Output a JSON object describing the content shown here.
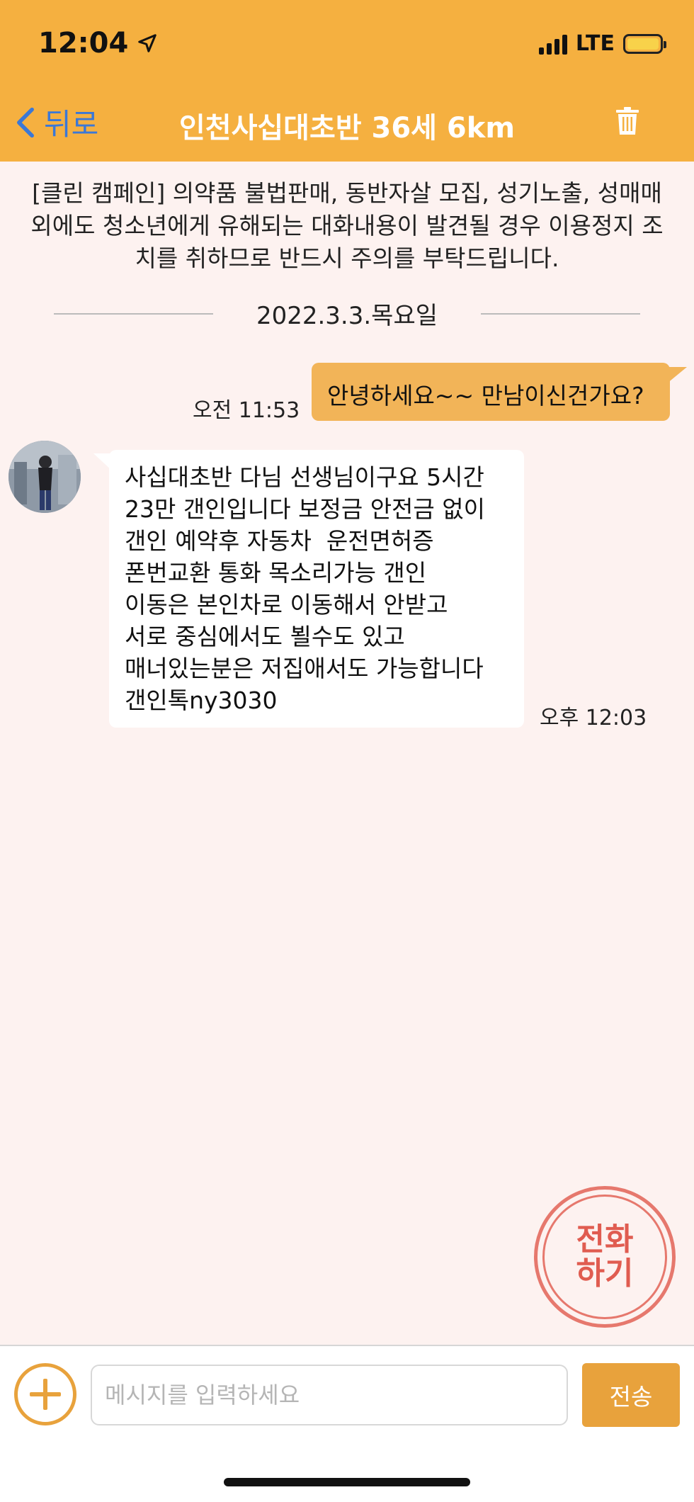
{
  "status_bar": {
    "time": "12:04",
    "network": "LTE",
    "battery_level": 1.0
  },
  "nav": {
    "back_label": "뒤로",
    "title": "인천사십대초반 36세 6km"
  },
  "notice": "[클린 캠페인] 의약품 불법판매, 동반자살 모집, 성기노출, 성매매 외에도 청소년에게 유해되는 대화내용이 발견될 경우 이용정지 조치를 취하므로 반드시 주의를 부탁드립니다.",
  "date_divider": "2022.3.3.목요일",
  "messages": {
    "outgoing": {
      "text": "안녕하세요~~ 만남이신건가요?",
      "time": "오전 11:53"
    },
    "incoming": {
      "lines": [
        "사십대초반 다님 선생님이구요 5시간",
        "23만 갠인입니다 보정금 안전금 없이",
        "갠인 예약후 자동차  운전면허증",
        "폰번교환 통화 목소리가능 갠인",
        "이동은 본인차로 이동해서 안받고",
        "서로 중심에서도 뵐수도 있고",
        "매너있는분은 저집애서도 가능합니다",
        "갠인톡ny3030"
      ],
      "time": "오후 12:03"
    }
  },
  "call_button": {
    "line1": "전화",
    "line2": "하기"
  },
  "composer": {
    "placeholder": "메시지를 입력하세요",
    "value": "",
    "send_label": "전송"
  },
  "colors": {
    "header": "#f5b040",
    "outgoing_bubble": "#f2b458",
    "accent": "#e8a23c",
    "call": "#e05c50",
    "background": "#fdf2f0"
  },
  "icons": [
    "location-arrow-icon",
    "signal-icon",
    "battery-icon",
    "chevron-left-icon",
    "trash-icon",
    "plus-icon"
  ]
}
